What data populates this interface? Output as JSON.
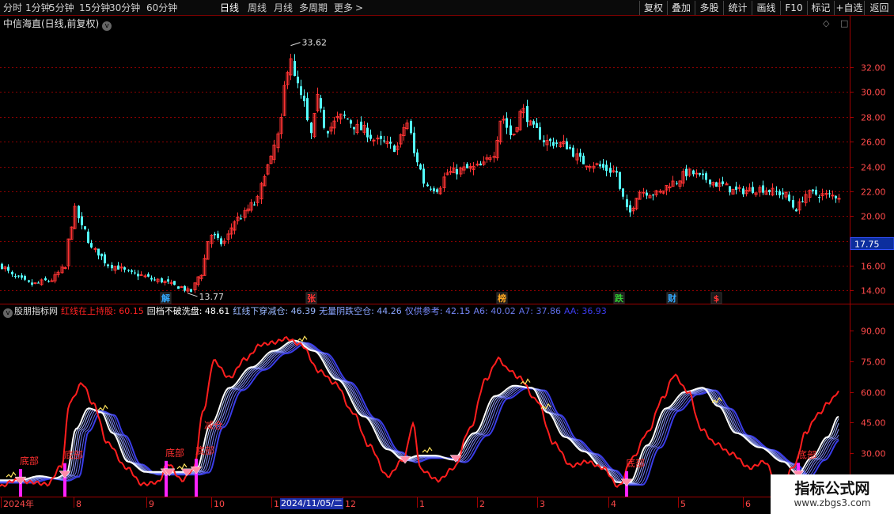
{
  "toolbar": {
    "periods": [
      {
        "label": "分时",
        "active": false
      },
      {
        "label": "1分钟",
        "active": false
      },
      {
        "label": "5分钟",
        "active": false
      },
      {
        "label": "15分钟",
        "active": false
      },
      {
        "label": "30分钟",
        "active": false
      },
      {
        "label": "60分钟",
        "active": false
      },
      {
        "label": "日线",
        "active": true
      },
      {
        "label": "周线",
        "active": false
      },
      {
        "label": "月线",
        "active": false
      },
      {
        "label": "多周期",
        "active": false
      },
      {
        "label": "更多",
        "active": false,
        "icon": "chevron-right-icon"
      }
    ],
    "tools": [
      "复权",
      "叠加",
      "多股",
      "统计",
      "画线",
      "F10",
      "标记",
      "+自选",
      "返回"
    ]
  },
  "price_panel": {
    "title": "中信海直(日线,前复权)",
    "dropdown_icon": "chevron-down-icon",
    "controls": {
      "diamond_icon": "◇",
      "maximize_icon": "□"
    },
    "high_label": "33.62",
    "low_label": "13.77",
    "current_price": "17.75",
    "event_markers": [
      {
        "label": "解",
        "color": "#33aaff"
      },
      {
        "label": "张",
        "color": "#ff3333"
      },
      {
        "label": "榜",
        "color": "#ffaa22"
      },
      {
        "label": "跌",
        "color": "#33cc33"
      },
      {
        "label": "财",
        "color": "#33aaff"
      },
      {
        "label": "$",
        "color": "#ff3333"
      }
    ]
  },
  "indicator_panel": {
    "name": "股朋指标网",
    "legend": [
      {
        "label": "红线在上持股:",
        "value": "60.15",
        "color": "#ff2222"
      },
      {
        "label": "回档不破洗盘:",
        "value": "48.61",
        "color": "#ffffff"
      },
      {
        "label": "红线下穿减仓:",
        "value": "46.39",
        "color": "#9ab8ff"
      },
      {
        "label": "无量阴跌空仓:",
        "value": "44.26",
        "color": "#8aa4ff"
      },
      {
        "label": "仅供参考:",
        "value": "42.15",
        "color": "#7a8cff"
      },
      {
        "label": "A6:",
        "value": "40.02",
        "color": "#6f7ff0"
      },
      {
        "label": "A7:",
        "value": "37.86",
        "color": "#5f6ee8"
      },
      {
        "label": "AA:",
        "value": "36.93",
        "color": "#3d3df0"
      }
    ],
    "bottom_label": "底部",
    "top_label": "减仓"
  },
  "time_axis": {
    "labels": [
      "2024年",
      "8",
      "9",
      "10",
      "1",
      "12",
      "1",
      "2",
      "3",
      "4",
      "5",
      "6"
    ],
    "cursor_date": "2024/11/05/二"
  },
  "watermark": {
    "title": "指标公式网",
    "url": "www.zbgs3.com"
  },
  "chart_data": [
    {
      "type": "candlestick",
      "title": "中信海直(日线,前复权)",
      "ylim": [
        13,
        35
      ],
      "yticks": [
        14.0,
        16.0,
        18.0,
        20.0,
        22.0,
        24.0,
        26.0,
        28.0,
        30.0,
        32.0
      ],
      "grid": true,
      "max_close": 33.62,
      "min_close": 13.77,
      "last_price": 17.75,
      "close_anchors": [
        [
          0,
          16.0
        ],
        [
          20,
          15.0
        ],
        [
          40,
          14.5
        ],
        [
          62,
          14.8
        ],
        [
          82,
          15.8
        ],
        [
          86,
          18.0
        ],
        [
          94,
          20.5
        ],
        [
          104,
          19.0
        ],
        [
          118,
          17.2
        ],
        [
          140,
          16.0
        ],
        [
          170,
          15.3
        ],
        [
          200,
          14.8
        ],
        [
          226,
          14.3
        ],
        [
          240,
          13.9
        ],
        [
          252,
          15.2
        ],
        [
          266,
          18.5
        ],
        [
          280,
          17.8
        ],
        [
          300,
          19.8
        ],
        [
          322,
          21.0
        ],
        [
          338,
          24.0
        ],
        [
          352,
          26.5
        ],
        [
          360,
          30.5
        ],
        [
          366,
          33.2
        ],
        [
          372,
          31.0
        ],
        [
          384,
          29.0
        ],
        [
          392,
          26.5
        ],
        [
          402,
          29.5
        ],
        [
          412,
          27.0
        ],
        [
          432,
          28.0
        ],
        [
          456,
          27.0
        ],
        [
          478,
          26.0
        ],
        [
          500,
          25.5
        ],
        [
          514,
          27.5
        ],
        [
          526,
          24.5
        ],
        [
          538,
          22.5
        ],
        [
          552,
          22.2
        ],
        [
          566,
          23.5
        ],
        [
          590,
          23.8
        ],
        [
          608,
          24.0
        ],
        [
          622,
          25.0
        ],
        [
          634,
          28.0
        ],
        [
          646,
          26.5
        ],
        [
          660,
          28.5
        ],
        [
          674,
          27.0
        ],
        [
          690,
          26.0
        ],
        [
          710,
          25.8
        ],
        [
          740,
          24.3
        ],
        [
          778,
          23.6
        ],
        [
          786,
          21.5
        ],
        [
          794,
          20.2
        ],
        [
          808,
          22.0
        ],
        [
          830,
          21.8
        ],
        [
          850,
          22.7
        ],
        [
          870,
          23.5
        ],
        [
          890,
          23.0
        ],
        [
          910,
          22.5
        ],
        [
          930,
          22.0
        ],
        [
          960,
          22.2
        ],
        [
          990,
          21.8
        ],
        [
          1005,
          20.6
        ],
        [
          1020,
          21.8
        ],
        [
          1062,
          21.6
        ]
      ],
      "event_markers": [
        "解",
        "张",
        "榜",
        "跌",
        "财",
        "$"
      ]
    },
    {
      "type": "line",
      "title": "股朋指标网",
      "ylim": [
        9,
        96
      ],
      "yticks": [
        15.0,
        30.0,
        45.0,
        60.0,
        75.0,
        90.0
      ],
      "series_legend": [
        {
          "name": "红线在上持股",
          "last": 60.15,
          "color": "#ff2222"
        },
        {
          "name": "回档不破洗盘",
          "last": 48.61,
          "color": "#ffffff"
        },
        {
          "name": "红线下穿减仓",
          "last": 46.39,
          "color": "#b8c8ff"
        },
        {
          "name": "无量阴跌空仓",
          "last": 44.26,
          "color": "#9aa8ff"
        },
        {
          "name": "仅供参考",
          "last": 42.15,
          "color": "#8a92ff"
        },
        {
          "name": "A6",
          "last": 40.02,
          "color": "#7078f0"
        },
        {
          "name": "A7",
          "last": 37.86,
          "color": "#5b62e8"
        },
        {
          "name": "AA",
          "last": 36.93,
          "color": "#3a3ce8"
        }
      ],
      "red_line_anchors": [
        [
          0,
          14
        ],
        [
          20,
          17
        ],
        [
          40,
          16
        ],
        [
          60,
          15
        ],
        [
          78,
          24
        ],
        [
          88,
          55
        ],
        [
          104,
          64
        ],
        [
          118,
          54
        ],
        [
          136,
          35
        ],
        [
          160,
          23
        ],
        [
          180,
          15
        ],
        [
          200,
          16
        ],
        [
          212,
          25
        ],
        [
          230,
          17
        ],
        [
          244,
          22
        ],
        [
          258,
          52
        ],
        [
          270,
          75
        ],
        [
          290,
          67
        ],
        [
          310,
          76
        ],
        [
          330,
          83
        ],
        [
          346,
          84
        ],
        [
          362,
          86
        ],
        [
          380,
          83
        ],
        [
          404,
          70
        ],
        [
          424,
          64
        ],
        [
          446,
          50
        ],
        [
          466,
          34
        ],
        [
          490,
          19
        ],
        [
          510,
          27
        ],
        [
          522,
          44
        ],
        [
          532,
          22
        ],
        [
          554,
          17
        ],
        [
          574,
          23
        ],
        [
          594,
          42
        ],
        [
          614,
          66
        ],
        [
          630,
          76
        ],
        [
          642,
          71
        ],
        [
          656,
          67
        ],
        [
          678,
          56
        ],
        [
          700,
          35
        ],
        [
          722,
          24
        ],
        [
          742,
          26
        ],
        [
          762,
          23
        ],
        [
          782,
          14
        ],
        [
          800,
          28
        ],
        [
          818,
          40
        ],
        [
          838,
          57
        ],
        [
          852,
          68
        ],
        [
          870,
          60
        ],
        [
          886,
          42
        ],
        [
          904,
          35
        ],
        [
          924,
          30
        ],
        [
          948,
          23
        ],
        [
          966,
          26
        ],
        [
          986,
          12
        ],
        [
          1004,
          24
        ],
        [
          1018,
          40
        ],
        [
          1034,
          49
        ],
        [
          1048,
          55
        ],
        [
          1060,
          60
        ]
      ],
      "white_line_anchors": [
        [
          0,
          17
        ],
        [
          24,
          17
        ],
        [
          50,
          19
        ],
        [
          70,
          18
        ],
        [
          84,
          20
        ],
        [
          96,
          42
        ],
        [
          112,
          52
        ],
        [
          128,
          50
        ],
        [
          142,
          40
        ],
        [
          162,
          26
        ],
        [
          184,
          21
        ],
        [
          210,
          21
        ],
        [
          236,
          21
        ],
        [
          248,
          22
        ],
        [
          266,
          44
        ],
        [
          290,
          62
        ],
        [
          318,
          72
        ],
        [
          346,
          80
        ],
        [
          372,
          85
        ],
        [
          396,
          80
        ],
        [
          426,
          66
        ],
        [
          460,
          48
        ],
        [
          490,
          32
        ],
        [
          510,
          27
        ],
        [
          530,
          29
        ],
        [
          550,
          29
        ],
        [
          572,
          27
        ],
        [
          600,
          40
        ],
        [
          626,
          58
        ],
        [
          650,
          63
        ],
        [
          672,
          62
        ],
        [
          692,
          50
        ],
        [
          714,
          38
        ],
        [
          738,
          31
        ],
        [
          762,
          23
        ],
        [
          780,
          16
        ],
        [
          796,
          16
        ],
        [
          818,
          34
        ],
        [
          842,
          52
        ],
        [
          866,
          60
        ],
        [
          888,
          62
        ],
        [
          908,
          53
        ],
        [
          930,
          40
        ],
        [
          960,
          33
        ],
        [
          990,
          26
        ],
        [
          1008,
          20
        ],
        [
          1026,
          28
        ],
        [
          1046,
          38
        ],
        [
          1060,
          48
        ]
      ],
      "signal_labels": [
        "底部",
        "减仓"
      ],
      "bottom_signal_count": 6
    }
  ]
}
